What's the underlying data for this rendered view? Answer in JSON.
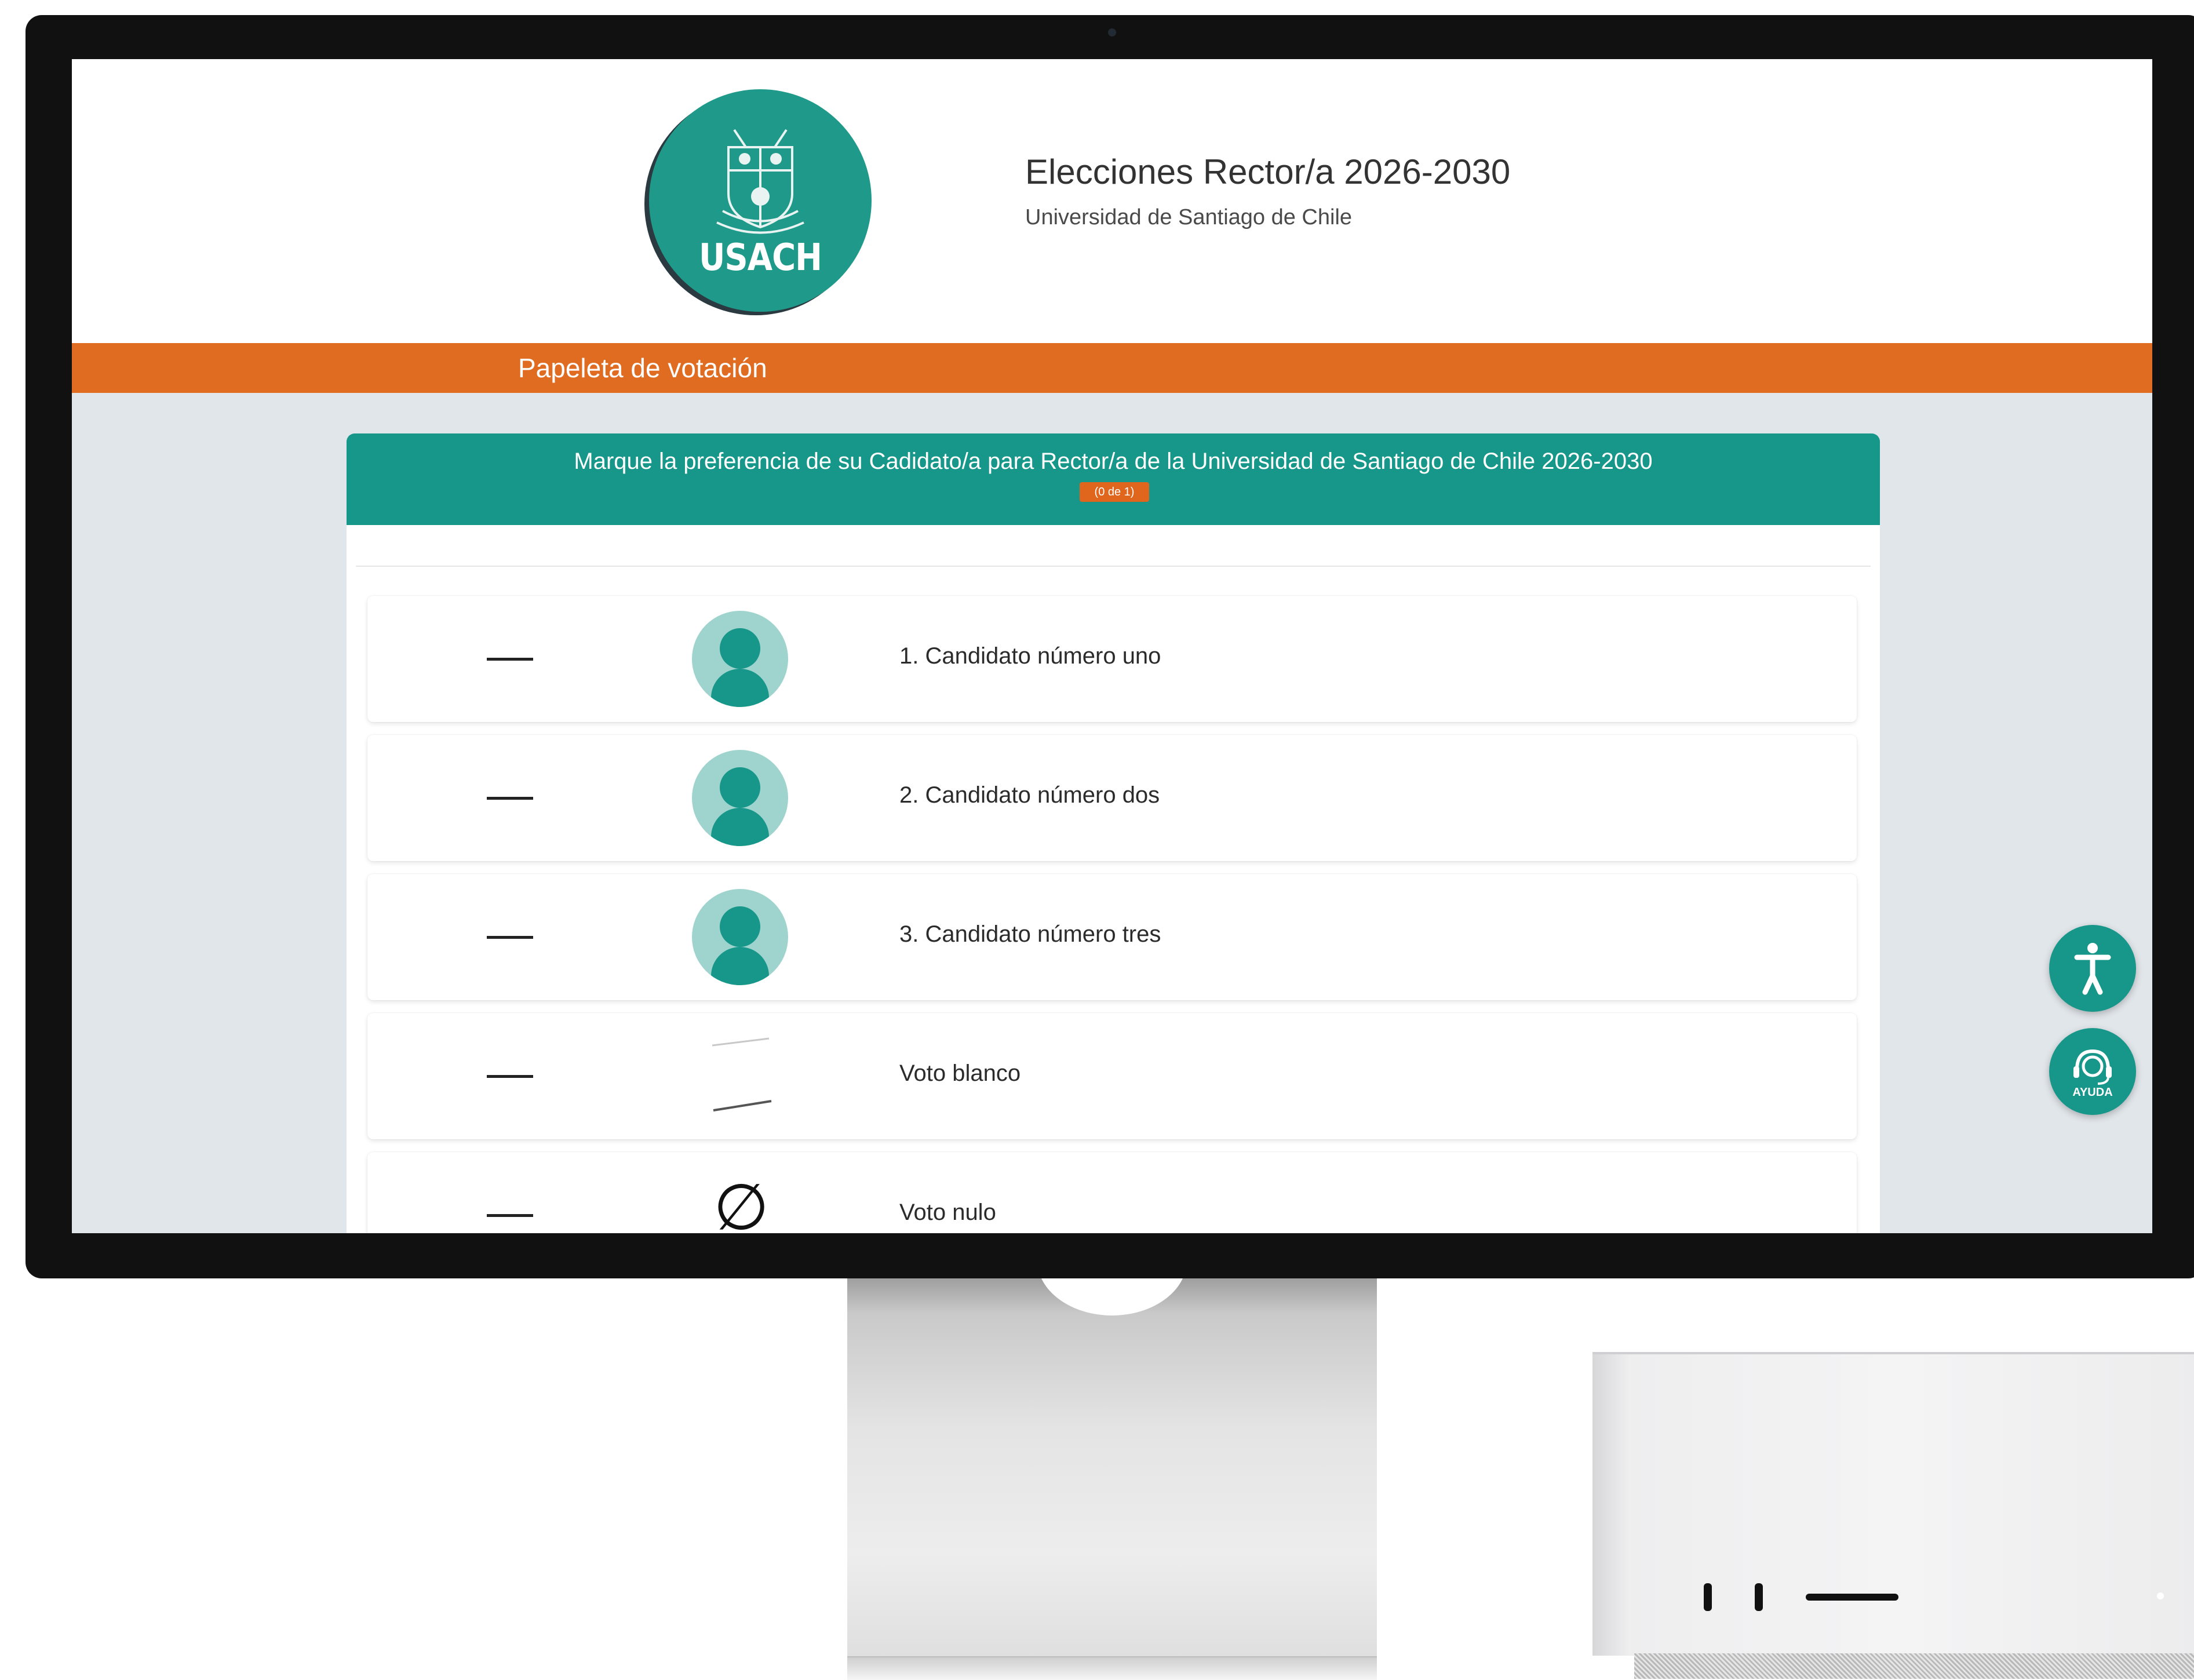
{
  "header": {
    "logo_text": "USACH",
    "title": "Elecciones Rector/a 2026-2030",
    "subtitle": "Universidad de Santiago de Chile"
  },
  "banner": {
    "label": "Papeleta de votación"
  },
  "ballot": {
    "instruction": "Marque la preferencia de su Cadidato/a para Rector/a de la Universidad de Santiago de Chile 2026-2030",
    "counter": "(0 de 1)",
    "options": [
      {
        "label": "1. Candidato número uno",
        "icon": "person-avatar-icon"
      },
      {
        "label": "2. Candidato número dos",
        "icon": "person-avatar-icon"
      },
      {
        "label": "3. Candidato número tres",
        "icon": "person-avatar-icon"
      },
      {
        "label": "Voto blanco",
        "icon": "blank-ballot-icon"
      },
      {
        "label": "Voto nulo",
        "icon": "null-vote-icon"
      }
    ],
    "null_symbol": "∅"
  },
  "fabs": {
    "accessibility_icon": "accessibility-icon",
    "help_label": "AYUDA",
    "help_icon": "headset-help-icon"
  },
  "colors": {
    "teal": "#16978a",
    "orange": "#e06c22",
    "background": "#e1e6ea"
  }
}
